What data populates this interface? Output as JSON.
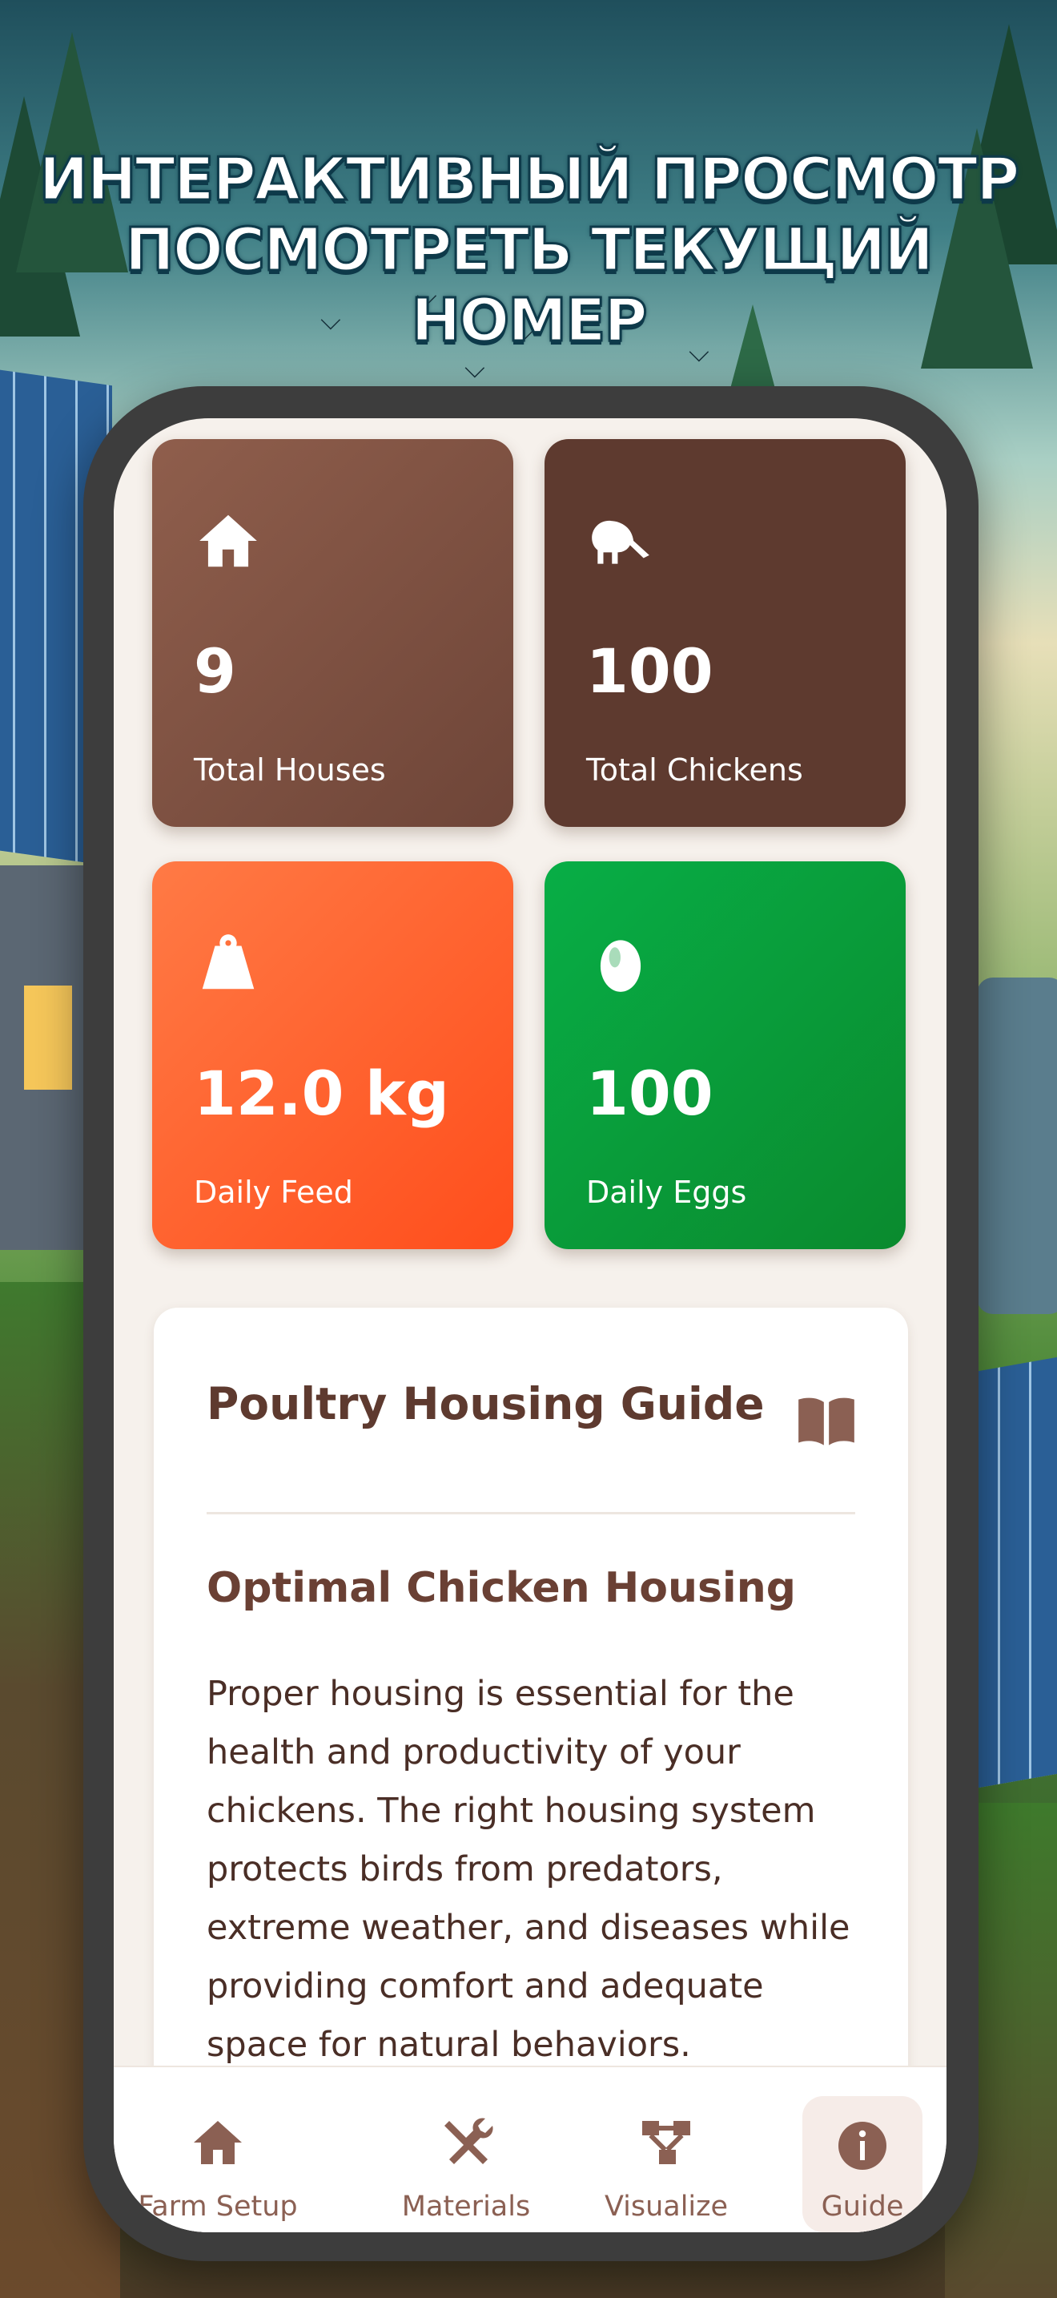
{
  "banner": {
    "line1": "ИНТЕРАКТИВНЫЙ ПРОСМОТР",
    "line2": "ПОСМОТРЕТЬ ТЕКУЩИЙ НОМЕР"
  },
  "stats": [
    {
      "icon": "house-icon",
      "value": "9",
      "label": "Total Houses",
      "color": "#7f5142"
    },
    {
      "icon": "chicken-icon",
      "value": "100",
      "label": "Total Chickens",
      "color": "#5e3a2f"
    },
    {
      "icon": "weight-icon",
      "value": "12.0 kg",
      "label": "Daily Feed",
      "color": "#ff5f2a"
    },
    {
      "icon": "egg-icon",
      "value": "100",
      "label": "Daily Eggs",
      "color": "#0a9a3a"
    }
  ],
  "guide": {
    "title": "Poultry Housing Guide",
    "icon": "book-icon",
    "subtitle": "Optimal Chicken Housing",
    "body": "Proper housing is essential for the health and productivity of your chickens. The right housing system protects birds from predators, extreme weather, and diseases while providing comfort and adequate space for natural behaviors."
  },
  "nav": {
    "active": "Guide",
    "items": [
      {
        "icon": "house-icon",
        "label": "Farm Setup"
      },
      {
        "icon": "tools-icon",
        "label": "Materials"
      },
      {
        "icon": "diagram-icon",
        "label": "Visualize"
      },
      {
        "icon": "info-icon",
        "label": "Guide"
      }
    ]
  },
  "colors": {
    "brown": "#5e3a2f",
    "background": "#f6f1ec",
    "accent_orange": "#ff5f2a",
    "accent_green": "#0a9a3a"
  }
}
